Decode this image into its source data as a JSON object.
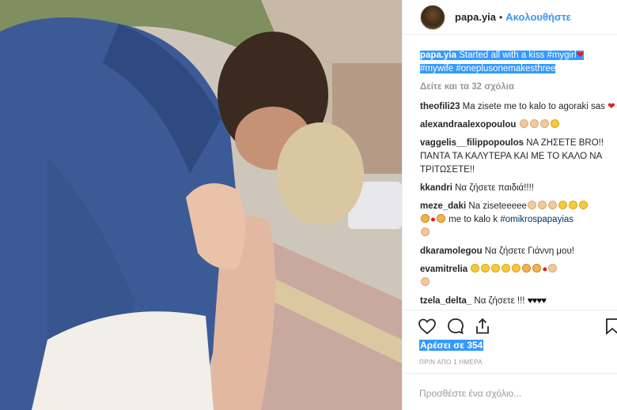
{
  "header": {
    "username": "papa.yia",
    "separator": "•",
    "follow_label": "Ακολουθήστε"
  },
  "caption": {
    "user": "papa.yia",
    "text": " Started all with a kiss ",
    "hashtag_1": "#mygirl",
    "hashtag_2": "#mywife",
    "hashtag_3": "#oneplusonemakesthree"
  },
  "view_all_label": "Δείτε και τα 32 σχόλια",
  "comments": [
    {
      "user": "theofili23",
      "text": " Ma zisete me to kalo to agoraki sas "
    },
    {
      "user": "alexandraalexopoulou",
      "text": " "
    },
    {
      "user": "vaggelis__filippopoulos",
      "text": " ΝΑ ΖΗΣΕΤΕ BRO!! ΠΑΝΤΑ ΤΑ ΚΑΛΥΤΕΡΑ ΚΑΙ ΜΕ ΤΟ ΚΑΛΟ ΝΑ ΤΡΙΤΩΣΕΤΕ!!"
    },
    {
      "user": "kkandri",
      "text": " Να ζήσετε παιδιά!!!!"
    },
    {
      "user": "meze_daki",
      "text": " Na ziseteeeee",
      "text_2": " me to kalo k ",
      "hashtag": "#omikrospapayias"
    },
    {
      "user": "dkaramolegou",
      "text": " Να ζήσετε Γιάννη μου!"
    },
    {
      "user": "evamitrelia",
      "text": " "
    },
    {
      "user": "tzela_delta_",
      "text": " Να ζήσετε !!! ",
      "hearts": "♥♥♥♥"
    }
  ],
  "likes_label": "Αρέσει σε 354",
  "time_label": "ΠΡΙΝ ΑΠΟ 1 ΗΜΕΡΑ",
  "add_comment_placeholder": "Προσθέστε ένα σχόλιο...",
  "icons": [
    "heart-icon",
    "comment-icon",
    "share-icon",
    "bookmark-icon"
  ],
  "colors": {
    "link_blue": "#3897f0",
    "selection": "#3399ff",
    "hashtag": "#003569"
  }
}
